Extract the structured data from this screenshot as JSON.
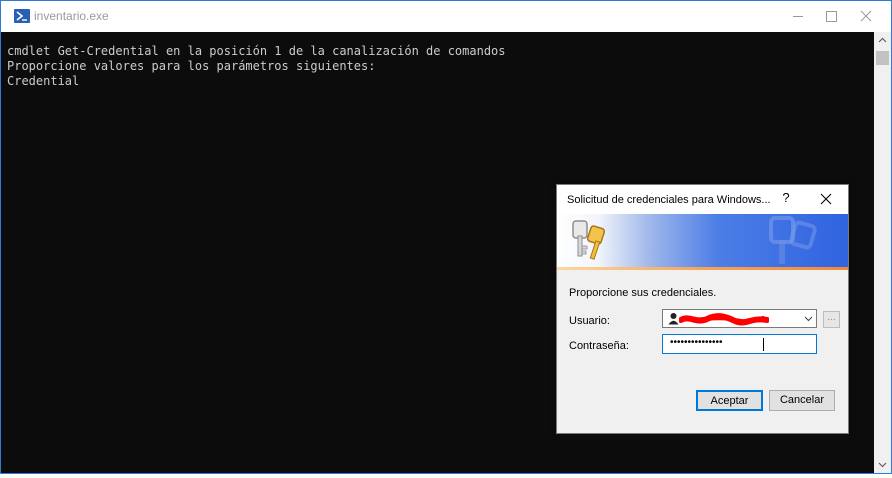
{
  "window": {
    "title": "inventario.exe",
    "icon": "powershell-icon"
  },
  "console": {
    "lines": [
      "cmdlet Get-Credential en la posición 1 de la canalización de comandos",
      "Proporcione valores para los parámetros siguientes:",
      "Credential"
    ]
  },
  "dialog": {
    "title": "Solicitud de credenciales para Windows...",
    "help_label": "?",
    "prompt": "Proporcione sus credenciales.",
    "user_label": "Usuario:",
    "user_value": "",
    "password_label": "Contraseña:",
    "password_mask": "•••••••••••••••",
    "browse_label": "...",
    "ok_label": "Aceptar",
    "cancel_label": "Cancelar"
  },
  "colors": {
    "accent": "#0078d7",
    "console_bg": "#0c0c0c",
    "console_text": "#cccccc",
    "redaction": "#ff0000"
  }
}
